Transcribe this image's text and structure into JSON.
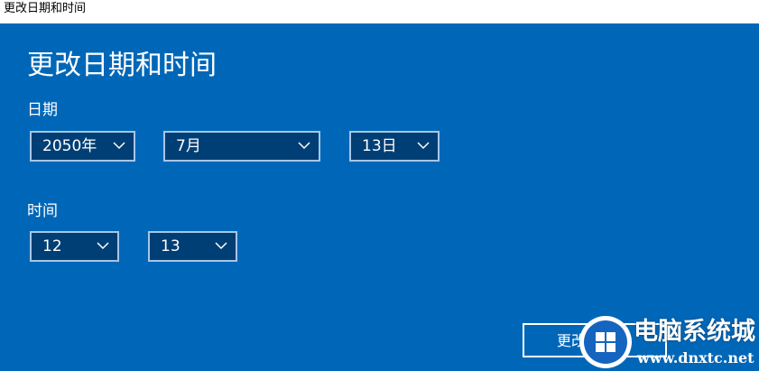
{
  "window": {
    "title": "更改日期和时间"
  },
  "page": {
    "heading": "更改日期和时间"
  },
  "date": {
    "label": "日期",
    "year": "2050年",
    "month": "7月",
    "day": "13日"
  },
  "time": {
    "label": "时间",
    "hour": "12",
    "minute": "13"
  },
  "actions": {
    "change_label": "更改"
  },
  "watermark": {
    "name": "电脑系统城",
    "url": "www.dnxtc.net"
  },
  "colors": {
    "panel_bg": "#0067b8",
    "select_bg": "#003f75",
    "select_border": "#a7c6e6",
    "text": "#ffffff"
  },
  "icons": {
    "chevron": "chevron-down-icon",
    "logo": "windows-logo-icon"
  }
}
